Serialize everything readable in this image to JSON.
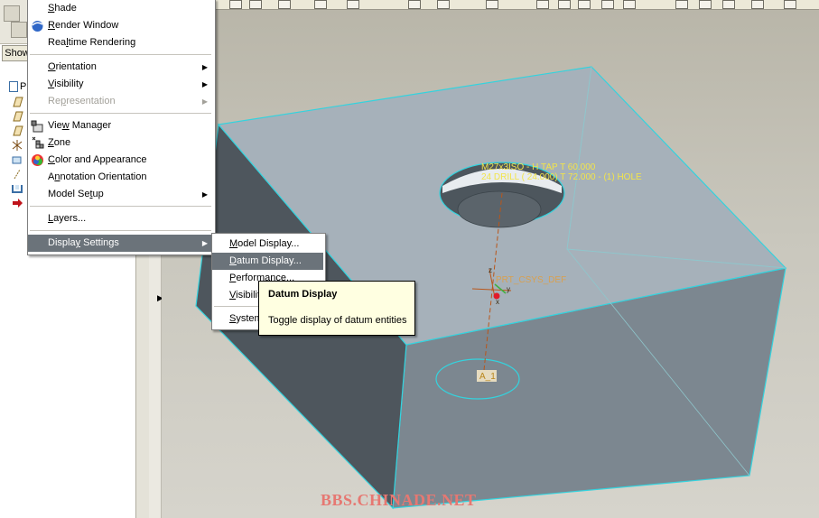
{
  "left_panel": {
    "show_tab": "Show",
    "tree_root": "PRT"
  },
  "main_menu": {
    "items": [
      {
        "key": "shade",
        "label": "Shade",
        "underline": "S",
        "icon": "shade-icon"
      },
      {
        "key": "render_window",
        "label": "Render Window",
        "underline": "R",
        "icon": "render-window-icon"
      },
      {
        "key": "realtime_rendering",
        "label": "Realtime Rendering",
        "underline": "l"
      },
      {
        "key": "orientation",
        "label": "Orientation",
        "underline": "O",
        "submenu": true
      },
      {
        "key": "visibility",
        "label": "Visibility",
        "underline": "V",
        "submenu": true
      },
      {
        "key": "representation",
        "label": "Representation",
        "underline": "p",
        "submenu": true,
        "disabled": true
      },
      {
        "key": "view_manager",
        "label": "View Manager",
        "underline": "w",
        "icon": "view-manager-icon"
      },
      {
        "key": "zone",
        "label": "Zone",
        "underline": "Z",
        "icon": "zone-icon"
      },
      {
        "key": "color_appearance",
        "label": "Color and Appearance",
        "underline": "C",
        "icon": "color-appearance-icon"
      },
      {
        "key": "annotation_orientation",
        "label": "Annotation Orientation",
        "underline": "n"
      },
      {
        "key": "model_setup",
        "label": "Model Setup",
        "underline": "t",
        "submenu": true
      },
      {
        "key": "layers",
        "label": "Layers...",
        "underline": "L"
      },
      {
        "key": "display_settings",
        "label": "Display Settings",
        "underline": "y",
        "submenu": true,
        "selected": true
      }
    ]
  },
  "submenu": {
    "items": [
      {
        "key": "model_display",
        "label": "Model Display...",
        "underline": "M"
      },
      {
        "key": "datum_display",
        "label": "Datum Display...",
        "underline": "D",
        "selected": true
      },
      {
        "key": "performance",
        "label": "Performance...",
        "underline": "P"
      },
      {
        "key": "visibilities",
        "label": "Visibilities...",
        "underline": "V"
      },
      {
        "key": "system_colors",
        "label": "System Colors...",
        "underline": "S"
      }
    ]
  },
  "tooltip": {
    "title": "Datum Display",
    "text": "Toggle display of datum entities"
  },
  "model": {
    "hole_note_line1": "M27x3ISO - H TAP T 60.000",
    "hole_note_line2": "24 DRILL ( 24.000) T 72.000 - (1) HOLE",
    "csys_label": "PRT_CSYS_DEF",
    "axis_label": "A_1",
    "csys_x": "x",
    "csys_y": "y",
    "csys_z": "z"
  },
  "watermark": "BBS.CHINADE.NET",
  "colors": {
    "edge": "#34d3de",
    "menu_selected": "#6b737a",
    "tooltip_bg": "#ffffe1",
    "note_text": "#f2e44a",
    "watermark": "#e67872"
  }
}
